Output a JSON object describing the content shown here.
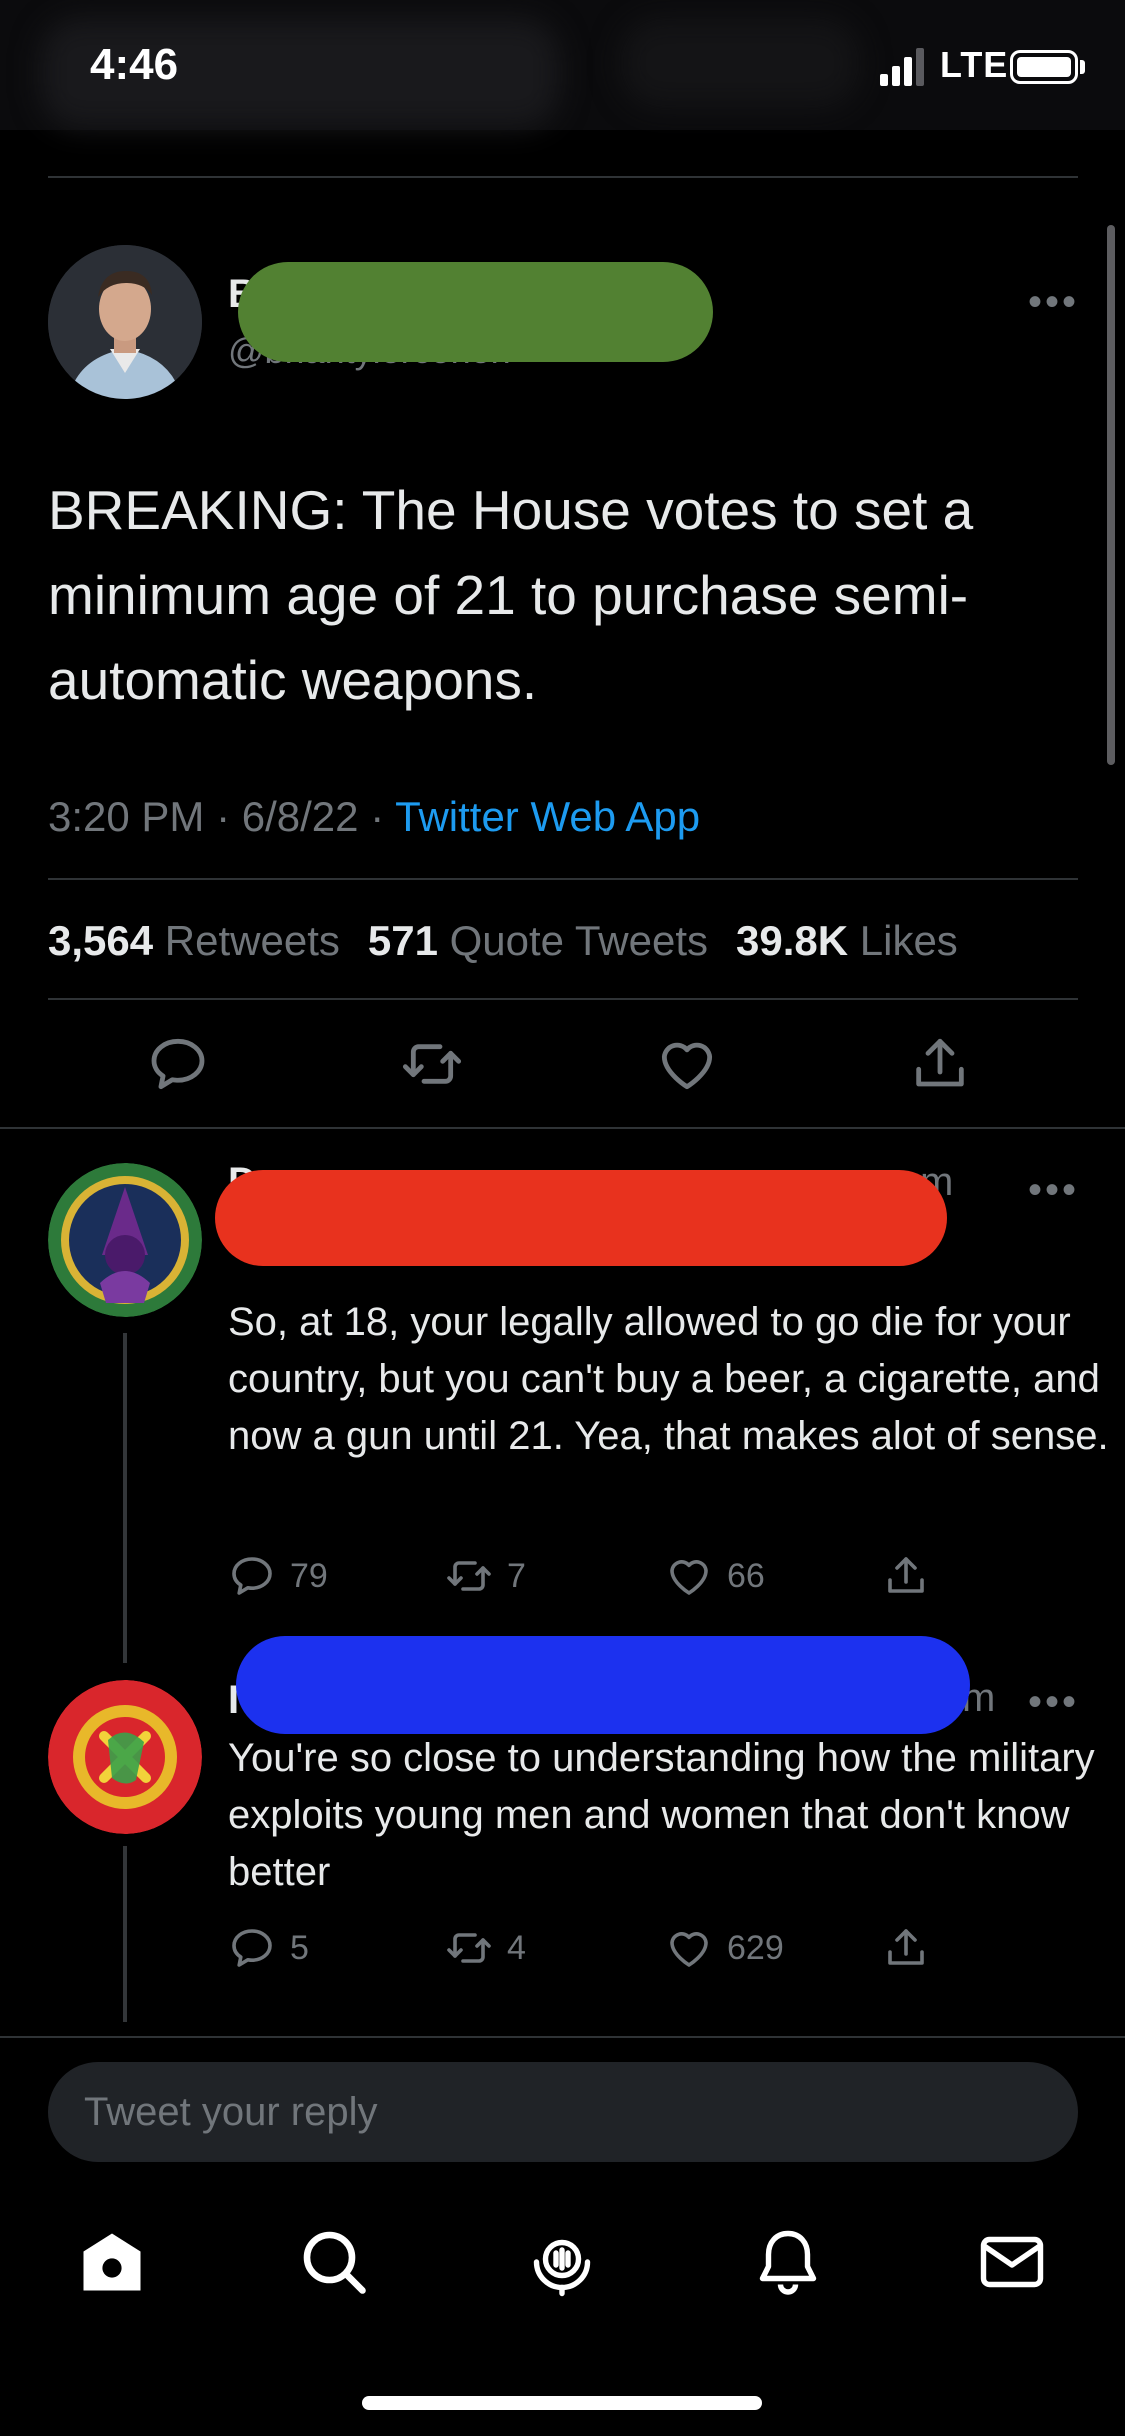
{
  "status_bar": {
    "time": "4:46",
    "network": "LTE"
  },
  "main_tweet": {
    "name_initial": "B",
    "handle": "@briantylercohen",
    "text": "BREAKING: The House votes to set a minimum age of 21 to purchase semi-automatic weapons.",
    "time": "3:20 PM",
    "date": "6/8/22",
    "source": "Twitter Web App",
    "retweets_count": "3,564",
    "retweets_label": "Retweets",
    "quotes_count": "571",
    "quotes_label": "Quote Tweets",
    "likes_count": "39.8K",
    "likes_label": "Likes"
  },
  "replies": [
    {
      "name_initial": "D",
      "time_suffix": "m",
      "text": "So, at 18, your legally allowed to go die for your country, but you can't buy a beer, a cigarette, and now a gun until 21. Yea, that makes alot of sense.",
      "replies": "79",
      "retweets": "7",
      "likes": "66"
    },
    {
      "name_initial": "I",
      "time_suffix": "m",
      "text": "You're so close to understanding how the military exploits young men and women that don't know better",
      "replies": "5",
      "retweets": "4",
      "likes": "629"
    }
  ],
  "composer": {
    "placeholder": "Tweet your reply"
  },
  "icons": {
    "reply": "reply-icon",
    "retweet": "retweet-icon",
    "like": "heart-icon",
    "share": "share-icon",
    "home": "home-icon",
    "search": "search-icon",
    "spaces": "spaces-icon",
    "notifications": "bell-icon",
    "messages": "mail-icon"
  },
  "colors": {
    "background": "#000000",
    "link": "#1d9bf0",
    "secondary_text": "#71767b",
    "redact_green": "#528132",
    "redact_red": "#e8321e",
    "redact_blue": "#1c31ef"
  }
}
